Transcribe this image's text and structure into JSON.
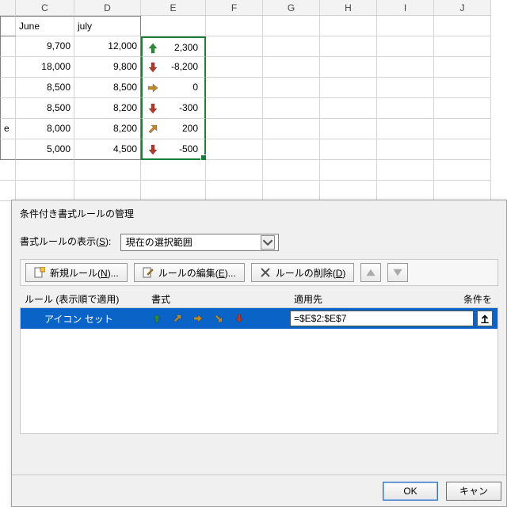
{
  "columns": [
    "C",
    "D",
    "E",
    "F",
    "G",
    "H",
    "I",
    "J"
  ],
  "header_row": {
    "C": "June",
    "D": "july"
  },
  "data_rows": [
    {
      "A": "",
      "C": "9,700",
      "D": "12,000",
      "E": {
        "icon": "up-green",
        "val": "2,300"
      }
    },
    {
      "A": "",
      "C": "18,000",
      "D": "9,800",
      "E": {
        "icon": "down-red",
        "val": "-8,200"
      }
    },
    {
      "A": "",
      "C": "8,500",
      "D": "8,500",
      "E": {
        "icon": "right-amber",
        "val": "0"
      }
    },
    {
      "A": "",
      "C": "8,500",
      "D": "8,200",
      "E": {
        "icon": "down-red",
        "val": "-300"
      }
    },
    {
      "A": "e",
      "C": "8,000",
      "D": "8,200",
      "E": {
        "icon": "diag-amber",
        "val": "200"
      }
    },
    {
      "A": "",
      "C": "5,000",
      "D": "4,500",
      "E": {
        "icon": "down-red",
        "val": "-500"
      }
    }
  ],
  "dialog": {
    "title": "条件付き書式ルールの管理",
    "show_rules_label": "書式ルールの表示",
    "show_rules_accel": "S",
    "scope_selected": "現在の選択範囲",
    "buttons": {
      "new": "新規ルール",
      "new_accel": "N",
      "edit": "ルールの編集",
      "edit_accel": "E",
      "delete": "ルールの削除",
      "delete_accel": "D"
    },
    "col_headers": {
      "rule": "ルール (表示順で適用)",
      "format": "書式",
      "applies": "適用先",
      "stop": "条件を"
    },
    "rule": {
      "name": "アイコン セット",
      "range": "=$E$2:$E$7"
    },
    "footer": {
      "ok": "OK",
      "cancel": "キャン"
    }
  },
  "icons": {
    "up-green": {
      "dir": "up",
      "fill": "#2e8b3d"
    },
    "down-red": {
      "dir": "down",
      "fill": "#b43a2c"
    },
    "right-amber": {
      "dir": "right",
      "fill": "#c08a2a"
    },
    "diag-amber": {
      "dir": "diag",
      "fill": "#c08a2a"
    }
  }
}
